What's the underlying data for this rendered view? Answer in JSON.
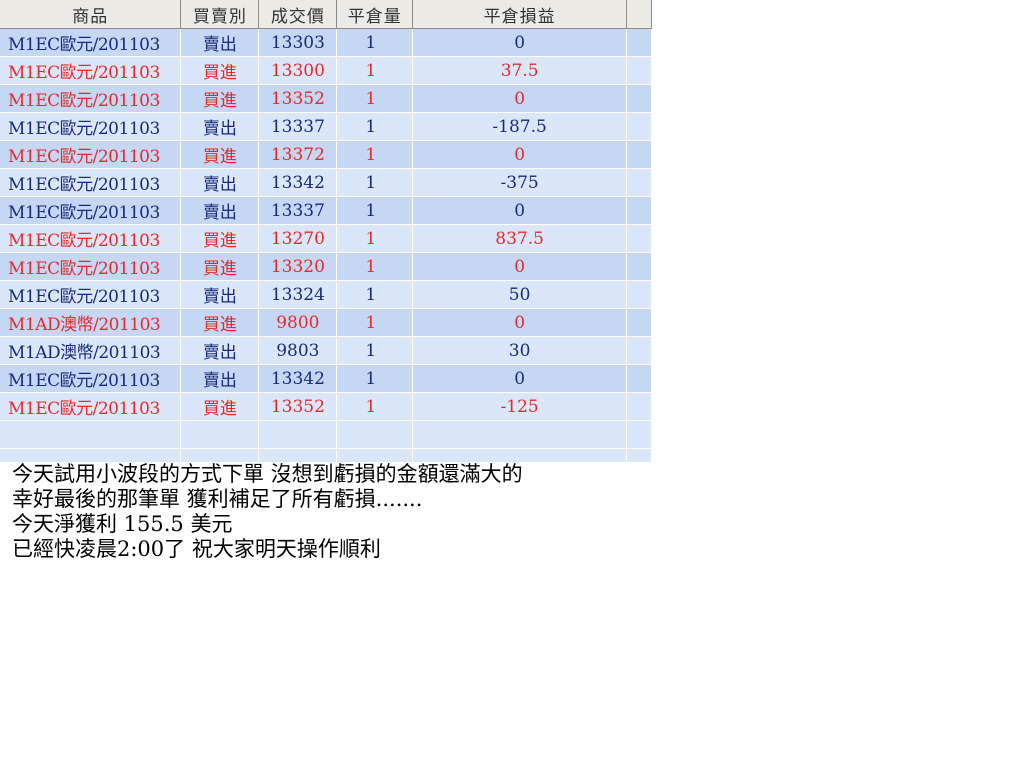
{
  "grid": {
    "columns": [
      "商品",
      "買賣別",
      "成交價",
      "平倉量",
      "平倉損益",
      ""
    ],
    "rows": [
      {
        "product": "M1EC歐元/201103",
        "side": "賣出",
        "price": "13303",
        "qty": "1",
        "pnl": "0",
        "type": "sell"
      },
      {
        "product": "M1EC歐元/201103",
        "side": "買進",
        "price": "13300",
        "qty": "1",
        "pnl": "37.5",
        "type": "buy"
      },
      {
        "product": "M1EC歐元/201103",
        "side": "買進",
        "price": "13352",
        "qty": "1",
        "pnl": "0",
        "type": "buy"
      },
      {
        "product": "M1EC歐元/201103",
        "side": "賣出",
        "price": "13337",
        "qty": "1",
        "pnl": "-187.5",
        "type": "sell"
      },
      {
        "product": "M1EC歐元/201103",
        "side": "買進",
        "price": "13372",
        "qty": "1",
        "pnl": "0",
        "type": "buy"
      },
      {
        "product": "M1EC歐元/201103",
        "side": "賣出",
        "price": "13342",
        "qty": "1",
        "pnl": "-375",
        "type": "sell"
      },
      {
        "product": "M1EC歐元/201103",
        "side": "賣出",
        "price": "13337",
        "qty": "1",
        "pnl": "0",
        "type": "sell"
      },
      {
        "product": "M1EC歐元/201103",
        "side": "買進",
        "price": "13270",
        "qty": "1",
        "pnl": "837.5",
        "type": "buy"
      },
      {
        "product": "M1EC歐元/201103",
        "side": "買進",
        "price": "13320",
        "qty": "1",
        "pnl": "0",
        "type": "buy"
      },
      {
        "product": "M1EC歐元/201103",
        "side": "賣出",
        "price": "13324",
        "qty": "1",
        "pnl": "50",
        "type": "sell"
      },
      {
        "product": "M1AD澳幣/201103",
        "side": "買進",
        "price": "9800",
        "qty": "1",
        "pnl": "0",
        "type": "buy"
      },
      {
        "product": "M1AD澳幣/201103",
        "side": "賣出",
        "price": "9803",
        "qty": "1",
        "pnl": "30",
        "type": "sell"
      },
      {
        "product": "M1EC歐元/201103",
        "side": "賣出",
        "price": "13342",
        "qty": "1",
        "pnl": "0",
        "type": "sell"
      },
      {
        "product": "M1EC歐元/201103",
        "side": "買進",
        "price": "13352",
        "qty": "1",
        "pnl": "-125",
        "type": "buy"
      }
    ]
  },
  "colors": {
    "sell": "#1a2a7a",
    "buy": "#e42a2a"
  },
  "note": {
    "lines": [
      "今天試用小波段的方式下單  沒想到虧損的金額還滿大的",
      "幸好最後的那筆單  獲利補足了所有虧損.......",
      "今天淨獲利  155.5 美元",
      "已經快凌晨2:00了 祝大家明天操作順利"
    ]
  }
}
